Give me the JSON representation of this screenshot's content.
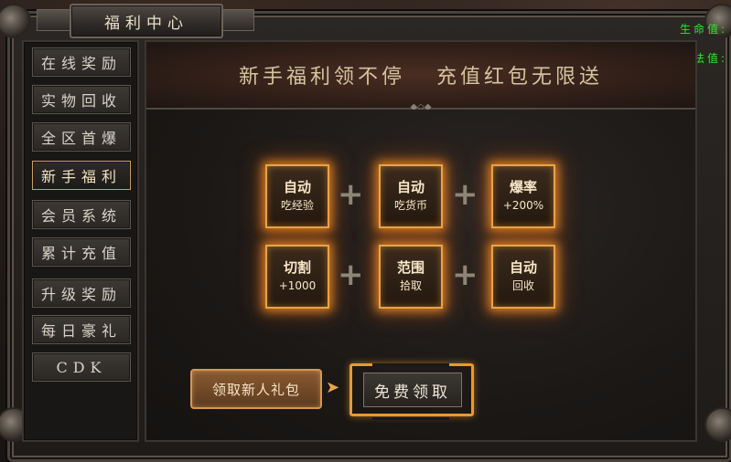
{
  "window": {
    "title": "福利中心"
  },
  "stats": {
    "hp_label": "生命值:",
    "mp_label": "魔法值:"
  },
  "sidebar": {
    "items": [
      {
        "label": "在线奖励",
        "active": false
      },
      {
        "label": "实物回收",
        "active": false
      },
      {
        "label": "全区首爆",
        "active": false
      },
      {
        "label": "新手福利",
        "active": true
      },
      {
        "label": "会员系统",
        "active": false
      },
      {
        "label": "累计充值",
        "active": false
      },
      {
        "label": "升级奖励",
        "active": false
      },
      {
        "label": "每日豪礼",
        "active": false
      },
      {
        "label": "CDK",
        "active": false
      }
    ]
  },
  "banner": {
    "left": "新手福利领不停",
    "right": "充值红包无限送"
  },
  "perks": [
    {
      "line1": "自动",
      "line2": "吃经验"
    },
    {
      "line1": "自动",
      "line2": "吃货币"
    },
    {
      "line1": "爆率",
      "line2": "+200%"
    },
    {
      "line1": "切割",
      "line2": "+1000"
    },
    {
      "line1": "范围",
      "line2": "拾取"
    },
    {
      "line1": "自动",
      "line2": "回收"
    }
  ],
  "plus_symbol": "+",
  "buttons": {
    "claim_new": "领取新人礼包",
    "free_claim": "免费领取",
    "arrow": "➤"
  },
  "colors": {
    "accent": "#e9a447",
    "stat_green": "#2ee82e",
    "active_border": "#c8a25a"
  }
}
